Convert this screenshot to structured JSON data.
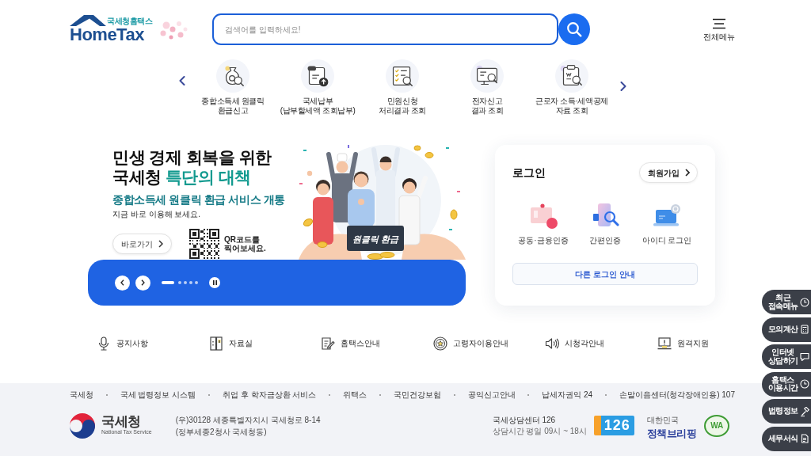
{
  "header": {
    "logo": {
      "caption": "국세청홈택스",
      "wordmark": "HomeTax"
    },
    "search": {
      "placeholder": "검색어를 입력하세요!"
    },
    "menu_label": "전체메뉴"
  },
  "quick_menu": {
    "items": [
      {
        "kind": "refund",
        "lines": [
          "종합소득세 원클릭",
          "환급신고"
        ]
      },
      {
        "kind": "payment",
        "lines": [
          "국세납부",
          "(납부할세액 조회납부)"
        ]
      },
      {
        "kind": "petition",
        "lines": [
          "민원신청",
          "처리결과 조회"
        ]
      },
      {
        "kind": "efiling",
        "lines": [
          "전자신고",
          "결과 조회"
        ]
      },
      {
        "kind": "deduction",
        "lines": [
          "근로자 소득·세액공제",
          "자료 조회"
        ]
      }
    ]
  },
  "banner": {
    "title": [
      "민생 경제 회복을 위한",
      "국세청"
    ],
    "title_highlight": "특단의 대책",
    "subtitle": "종합소득세 원클릭 환급 서비스 개통",
    "note": "지금 바로 이용해 보세요.",
    "button": "바로가기",
    "qr_caption": [
      "QR코드를",
      "찍어보세요."
    ],
    "sign": "원클릭 환급",
    "slides": [
      {
        "selected": true
      },
      {
        "selected": false
      },
      {
        "selected": false
      },
      {
        "selected": false
      },
      {
        "selected": false
      }
    ],
    "playing": true
  },
  "login": {
    "title": "로그인",
    "signup": "회원가입",
    "methods": [
      {
        "kind": "certificate",
        "label": "공동·금융인증"
      },
      {
        "kind": "simple",
        "label": "간편인증"
      },
      {
        "kind": "id",
        "label": "아이디 로그인"
      }
    ],
    "other": "다른 로그인 안내"
  },
  "shortcuts": [
    {
      "kind": "mic",
      "label": "공지사항"
    },
    {
      "kind": "cabinet",
      "label": "자료실"
    },
    {
      "kind": "note",
      "label": "홈택스안내"
    },
    {
      "kind": "badge",
      "label": "고령자이용안내"
    },
    {
      "kind": "speaker",
      "label": "시청각안내"
    },
    {
      "kind": "monitor",
      "label": "원격지원"
    }
  ],
  "footer": {
    "links": [
      "국세청",
      "국세 법령정보 시스템",
      "취업 후 학자금상환 서비스",
      "위택스",
      "국민건강보험",
      "공익신고안내",
      "납세자권익 24",
      "손말이음센터(청각장애인용) 107"
    ],
    "agency": {
      "name": "국세청",
      "english": "National Tax Service"
    },
    "address": [
      "(우)30128 세종특별자치시 국세청로 8-14",
      "(정부세종2청사 국세청동)"
    ],
    "center": {
      "title": "국세상담센터 126",
      "hours": "상담시간 평일 09시 ~ 18시"
    },
    "hotline": "126",
    "briefing": {
      "small": "대한민국",
      "name": "정책브리핑"
    },
    "accessibility_mark": "WA"
  },
  "side_menu": [
    {
      "kind": "clock",
      "lines": [
        "최근",
        "접속메뉴"
      ]
    },
    {
      "kind": "calculator",
      "lines": [
        "모의계산"
      ]
    },
    {
      "kind": "chat",
      "lines": [
        "인터넷",
        "상담하기"
      ]
    },
    {
      "kind": "time",
      "lines": [
        "홈택스",
        "이용시간"
      ]
    },
    {
      "kind": "law",
      "lines": [
        "법령정보"
      ]
    },
    {
      "kind": "form",
      "lines": [
        "세무서식"
      ]
    }
  ]
}
